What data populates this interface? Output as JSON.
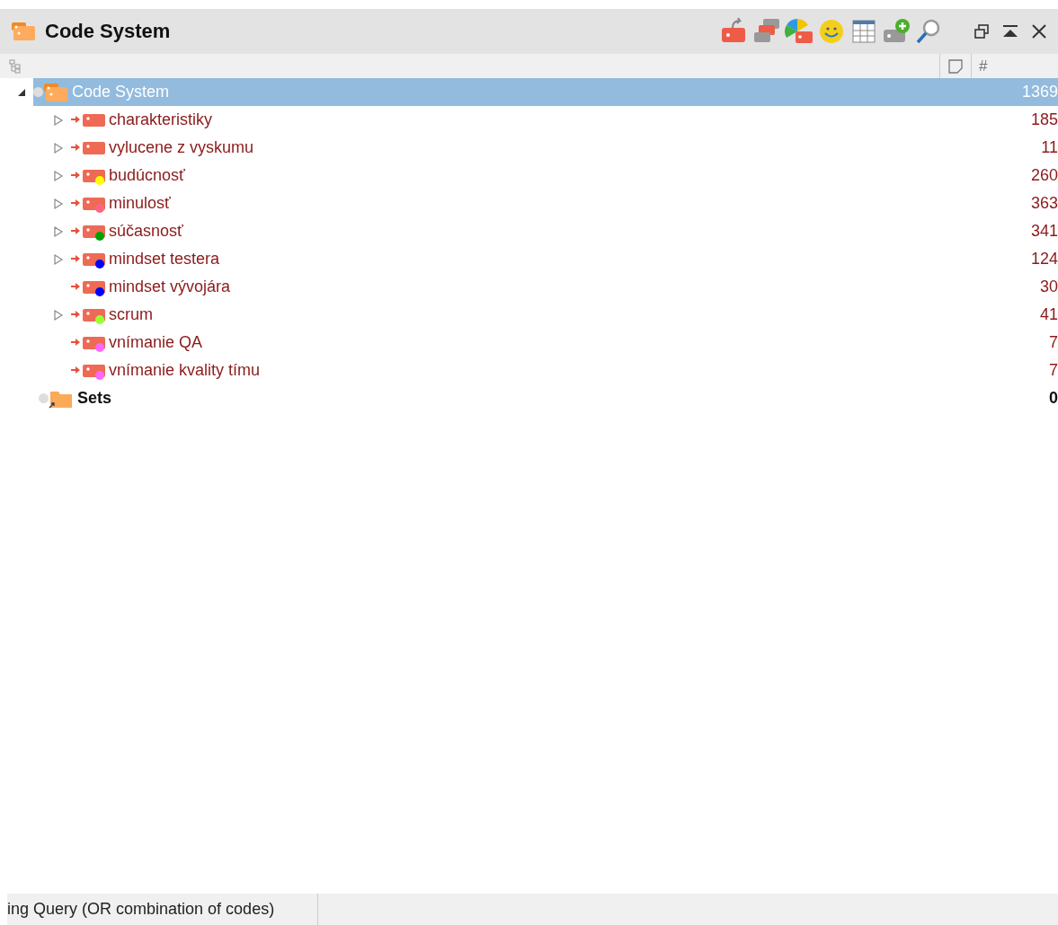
{
  "window": {
    "title": "Code System"
  },
  "columns": [
    {
      "kind": "memo"
    },
    {
      "kind": "count",
      "label": "#"
    }
  ],
  "tree": {
    "label": "Code System",
    "count": "1369",
    "selected": true,
    "expanded": true,
    "children": [
      {
        "label": "charakteristiky",
        "count": "185",
        "expanded": false,
        "selected": false
      },
      {
        "label": "vylucene z vyskumu",
        "count": "11",
        "expanded": false,
        "selected": false
      },
      {
        "label": "budúcnosť",
        "count": "260",
        "expanded": false,
        "selected": false,
        "color": "#ffff00"
      },
      {
        "label": "minulosť",
        "count": "363",
        "expanded": false,
        "selected": false,
        "color": "#ff6680"
      },
      {
        "label": "súčasnosť",
        "count": "341",
        "expanded": false,
        "selected": false,
        "color": "#00a000"
      },
      {
        "label": "mindset testera",
        "count": "124",
        "expanded": false,
        "selected": false,
        "color": "#0000ff"
      },
      {
        "label": "mindset vývojára",
        "count": "30",
        "selected": false,
        "color": "#0000ff"
      },
      {
        "label": "scrum",
        "count": "41",
        "expanded": false,
        "selected": false,
        "color": "#99ff33"
      },
      {
        "label": "vnímanie QA",
        "count": "7",
        "selected": false,
        "color": "#ff66ff"
      },
      {
        "label": "vnímanie kvality tímu",
        "count": "7",
        "selected": false,
        "color": "#ff66ff"
      }
    ]
  },
  "sets": {
    "label": "Sets",
    "count": "0",
    "selected": false
  },
  "status_bar": {
    "text": "ing Query (OR combination of codes)"
  }
}
